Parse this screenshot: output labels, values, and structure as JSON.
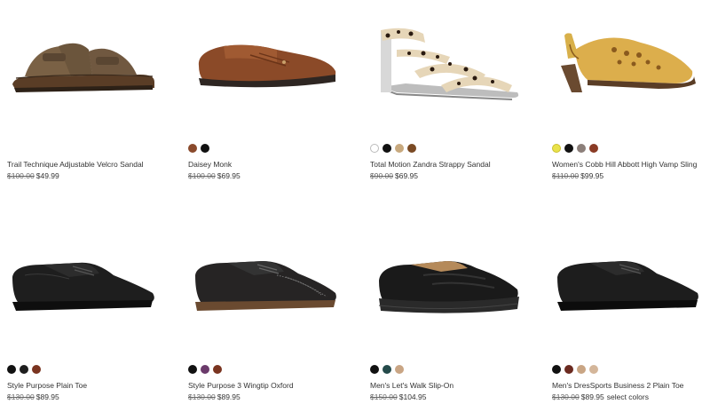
{
  "products": [
    {
      "name": "Trail Technique Adjustable Velcro Sandal",
      "original_price": "$100.00",
      "sale_price": "$49.99",
      "note": "",
      "swatches": [],
      "image": "brown-sport-sandal"
    },
    {
      "name": "Daisey Monk",
      "original_price": "$100.00",
      "sale_price": "$69.95",
      "note": "",
      "swatches": [
        "#8a4a2c",
        "#111111"
      ],
      "image": "brown-leather-slip-on"
    },
    {
      "name": "Total Motion Zandra Strappy Sandal",
      "original_price": "$90.00",
      "sale_price": "$69.95",
      "note": "",
      "swatches": [
        "#ffffff",
        "#111111",
        "#c8a97e",
        "#7a4a24"
      ],
      "image": "leopard-strappy-sandal"
    },
    {
      "name": "Women's Cobb Hill Abbott High Vamp Sling",
      "original_price": "$110.00",
      "sale_price": "$99.95",
      "note": "",
      "swatches": [
        "#e9e24a",
        "#111111",
        "#8c7f7a",
        "#8a3b25"
      ],
      "image": "yellow-heeled-slingback"
    },
    {
      "name": "Style Purpose Plain Toe",
      "original_price": "$130.00",
      "sale_price": "$89.95",
      "note": "",
      "swatches": [
        "#111111",
        "#1e1e1e",
        "#7a3420"
      ],
      "image": "black-derby-shoe"
    },
    {
      "name": "Style Purpose 3 Wingtip Oxford",
      "original_price": "$130.00",
      "sale_price": "$89.95",
      "note": "",
      "swatches": [
        "#111111",
        "#6b3a6b",
        "#7a3420"
      ],
      "image": "black-wingtip-oxford"
    },
    {
      "name": "Men's Let's Walk Slip-On",
      "original_price": "$150.00",
      "sale_price": "$104.95",
      "note": "",
      "swatches": [
        "#111111",
        "#244a4a",
        "#c9a584"
      ],
      "image": "black-walking-slip-on"
    },
    {
      "name": "Men's DresSports Business 2 Plain Toe",
      "original_price": "$130.00",
      "sale_price": "$89.95",
      "note": "select colors",
      "swatches": [
        "#111111",
        "#6b2a20",
        "#c9a584",
        "#d4b69a"
      ],
      "image": "black-plain-toe-dress-shoe"
    }
  ]
}
